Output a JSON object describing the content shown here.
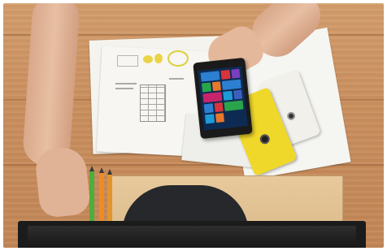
{
  "scene": {
    "tiles": [
      {
        "color": "#2d7fd1",
        "wide": true
      },
      {
        "color": "#d9343a",
        "wide": false
      },
      {
        "color": "#7a3fbf",
        "wide": false
      },
      {
        "color": "#2aa44b",
        "wide": false
      },
      {
        "color": "#e8762b",
        "wide": false
      },
      {
        "color": "#2d7fd1",
        "wide": true
      },
      {
        "color": "#c8246b",
        "wide": true
      },
      {
        "color": "#1e9bd7",
        "wide": false
      },
      {
        "color": "#3c5fbf",
        "wide": false
      },
      {
        "color": "#2d7fd1",
        "wide": false
      },
      {
        "color": "#d9343a",
        "wide": false
      },
      {
        "color": "#2aa44b",
        "wide": true
      },
      {
        "color": "#1e9bd7",
        "wide": false
      },
      {
        "color": "#e8762b",
        "wide": false
      }
    ],
    "pencils": [
      {
        "color": "#4caf3a"
      },
      {
        "color": "#f08a24"
      },
      {
        "color": "#e0962c"
      }
    ]
  }
}
